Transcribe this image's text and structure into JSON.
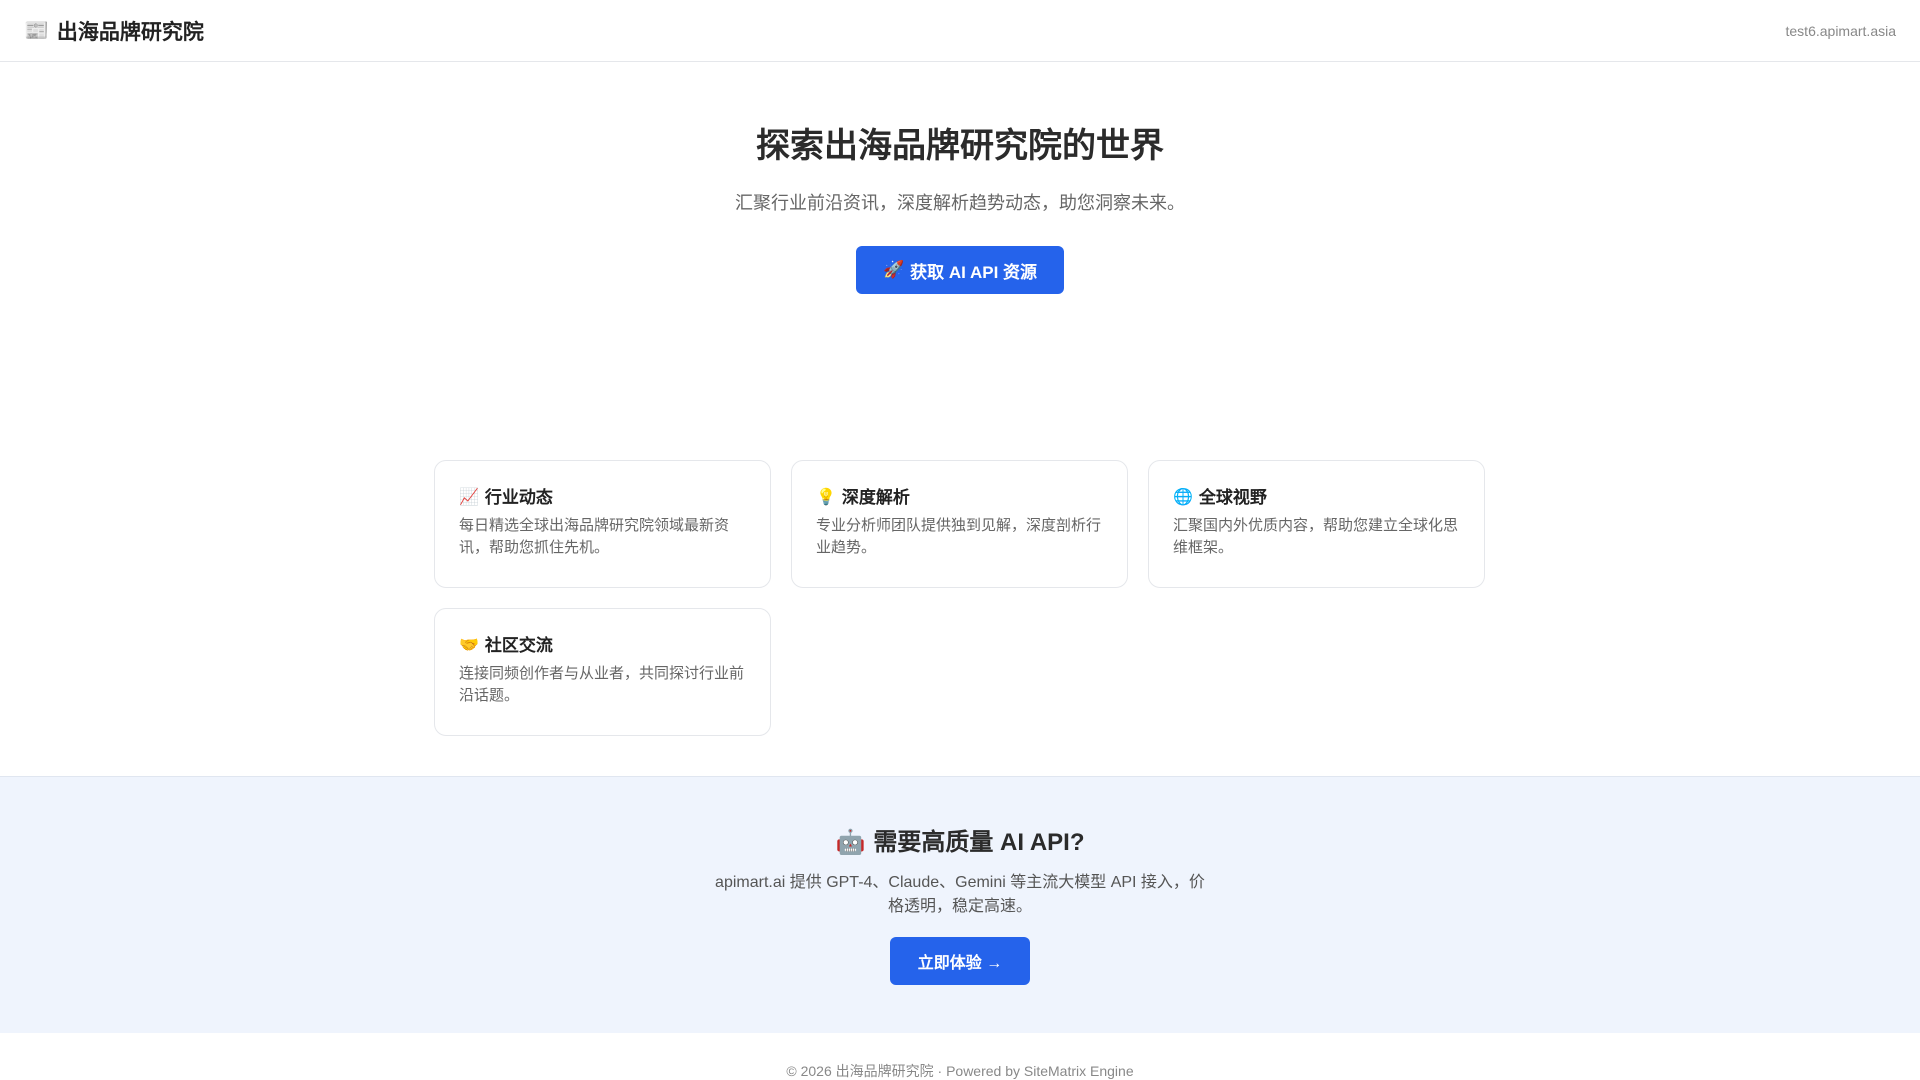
{
  "header": {
    "logo_icon": "📰",
    "site_name": "出海品牌研究院",
    "domain": "test6.apimart.asia"
  },
  "hero": {
    "title": "探索出海品牌研究院的世界",
    "subtitle": "汇聚行业前沿资讯，深度解析趋势动态，助您洞察未来。",
    "button_icon": "🚀",
    "button_label": "获取 AI API 资源"
  },
  "features": [
    {
      "icon": "📈",
      "title": "行业动态",
      "desc": "每日精选全球出海品牌研究院领域最新资讯，帮助您抓住先机。"
    },
    {
      "icon": "💡",
      "title": "深度解析",
      "desc": "专业分析师团队提供独到见解，深度剖析行业趋势。"
    },
    {
      "icon": "🌐",
      "title": "全球视野",
      "desc": "汇聚国内外优质内容，帮助您建立全球化思维框架。"
    },
    {
      "icon": "🤝",
      "title": "社区交流",
      "desc": "连接同频创作者与从业者，共同探讨行业前沿话题。"
    }
  ],
  "promo": {
    "icon": "🤖",
    "title": "需要高质量 AI API?",
    "text": "apimart.ai 提供 GPT-4、Claude、Gemini 等主流大模型 API 接入，价格透明，稳定高速。",
    "button_label": "立即体验 →"
  },
  "footer": {
    "text": "© 2026 出海品牌研究院 · Powered by SiteMatrix Engine"
  },
  "colors": {
    "accent": "#2563eb",
    "promo_bg": "#eff4fd",
    "border": "#e5e7eb"
  }
}
